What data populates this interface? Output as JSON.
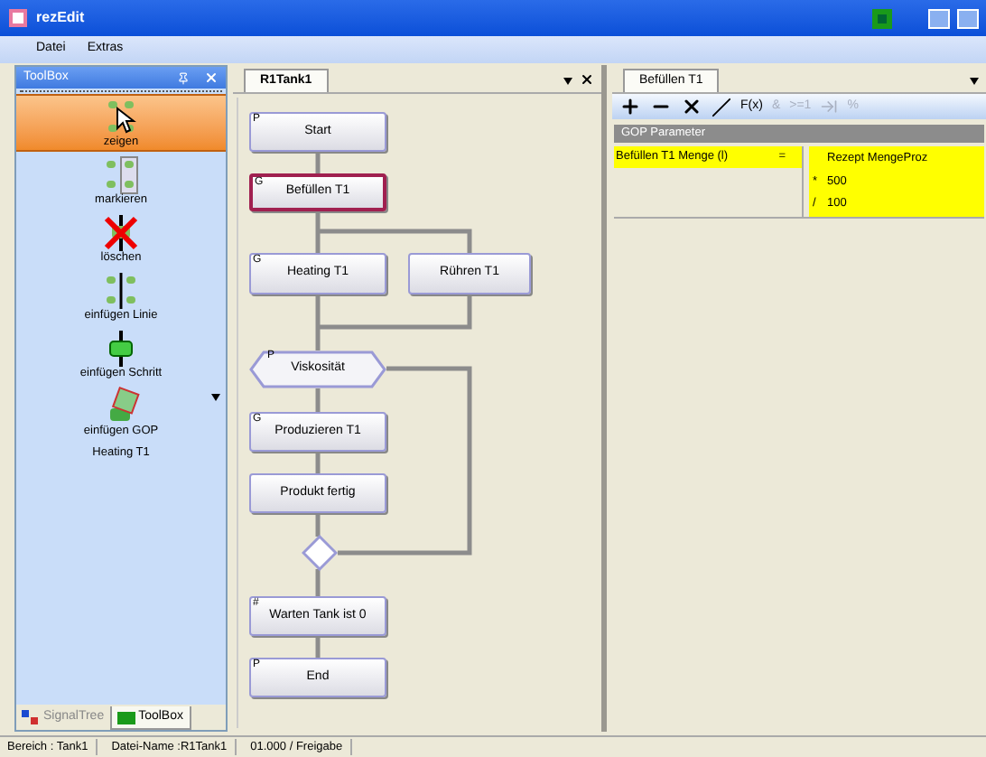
{
  "window": {
    "title": "rezEdit"
  },
  "menu": [
    "Datei",
    "Extras"
  ],
  "toolbox": {
    "title": "ToolBox",
    "items": [
      {
        "label": "zeigen",
        "selected": true
      },
      {
        "label": "markieren",
        "selected": false
      },
      {
        "label": "löschen",
        "selected": false
      },
      {
        "label": "einfügen Linie",
        "selected": false
      },
      {
        "label": "einfügen Schritt",
        "selected": false
      },
      {
        "label": "einfügen GOP",
        "selected": false
      }
    ],
    "current": "Heating T1",
    "tabs": [
      {
        "label": "SignalTree",
        "selected": false
      },
      {
        "label": "ToolBox",
        "selected": true
      }
    ]
  },
  "document": {
    "tab": "R1Tank1",
    "nodes": [
      {
        "kind": "step",
        "mark": "P",
        "label": "Start",
        "selected": false
      },
      {
        "kind": "step",
        "mark": "G",
        "label": "Befüllen T1",
        "selected": true
      },
      {
        "kind": "step",
        "mark": "G",
        "label": "Heating T1",
        "selected": false
      },
      {
        "kind": "step",
        "label": "Rühren T1",
        "selected": false
      },
      {
        "kind": "branch",
        "mark": "P",
        "label": "Viskosität",
        "selected": false
      },
      {
        "kind": "step",
        "mark": "G",
        "label": "Produzieren T1",
        "selected": false
      },
      {
        "kind": "step",
        "label": "Produkt fertig",
        "selected": false
      },
      {
        "kind": "merge",
        "selected": false
      },
      {
        "kind": "step",
        "mark": "#",
        "label": "Warten Tank ist 0",
        "selected": false
      },
      {
        "kind": "step",
        "mark": "P",
        "label": "End",
        "selected": false
      }
    ]
  },
  "parameters": {
    "tab": "Befüllen T1",
    "toolbar": [
      {
        "kind": "icon",
        "disabled": false
      },
      {
        "kind": "icon",
        "disabled": false
      },
      {
        "kind": "icon",
        "disabled": false
      },
      {
        "kind": "icon",
        "disabled": false
      },
      {
        "kind": "text",
        "label": "F(x)",
        "disabled": false
      },
      {
        "kind": "text",
        "label": "&",
        "disabled": true
      },
      {
        "kind": "text",
        "label": ">=1",
        "disabled": true
      },
      {
        "kind": "icon",
        "disabled": true
      },
      {
        "kind": "text",
        "label": "%",
        "disabled": true
      }
    ],
    "section": "GOP Parameter",
    "target": "Befüllen T1 Menge (l)",
    "operator": "=",
    "expression": [
      {
        "value": "Rezept MengeProz"
      },
      {
        "op": "*",
        "value": "500"
      },
      {
        "op": "/",
        "value": "100"
      }
    ]
  },
  "status_bar": [
    "Bereich : Tank1",
    "Datei-Name :R1Tank1",
    "01.000 / Freigabe"
  ]
}
